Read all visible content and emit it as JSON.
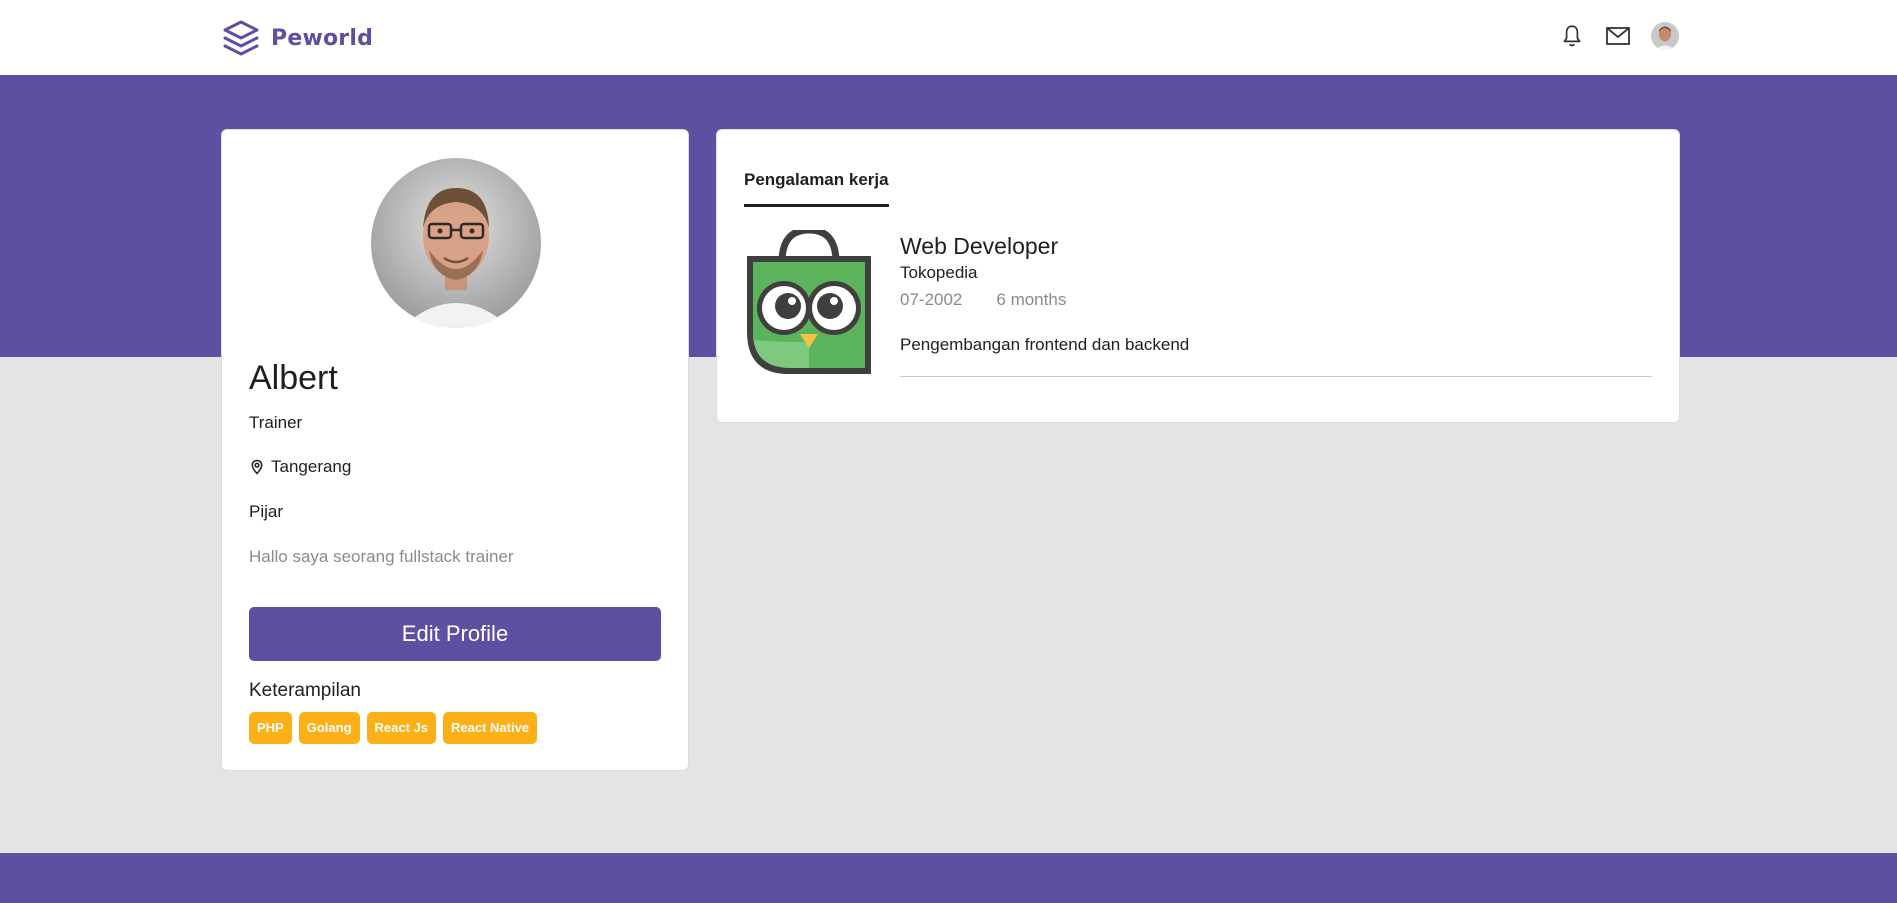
{
  "brand": {
    "name": "Peworld",
    "color": "#5e50a1"
  },
  "nav": {
    "icons": [
      "bell-icon",
      "mail-icon",
      "avatar"
    ]
  },
  "profile": {
    "name": "Albert",
    "role": "Trainer",
    "location": "Tangerang",
    "company": "Pijar",
    "bio": "Hallo saya seorang fullstack trainer",
    "edit_label": "Edit Profile",
    "skills_title": "Keterampilan",
    "skills": [
      "PHP",
      "Golang",
      "React Js",
      "React Native"
    ]
  },
  "experience": {
    "tab_label": "Pengalaman kerja",
    "items": [
      {
        "position": "Web Developer",
        "company": "Tokopedia",
        "date": "07-2002",
        "duration": "6 months",
        "description": "Pengembangan frontend dan backend"
      }
    ]
  },
  "colors": {
    "primary": "#5e50a1",
    "skill": "#fbb017",
    "background": "#e4e4e4"
  }
}
